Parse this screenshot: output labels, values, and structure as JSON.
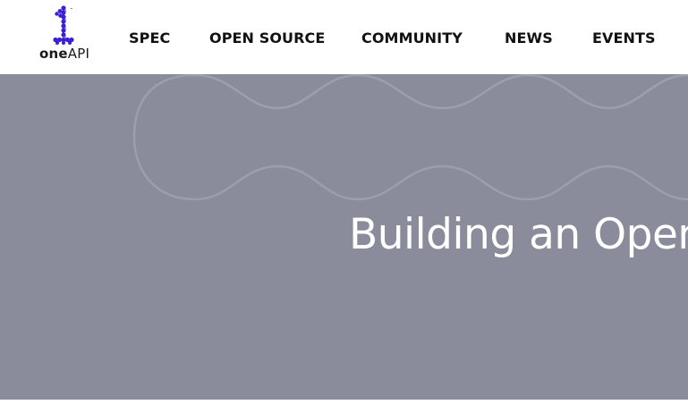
{
  "brand": {
    "logo_icon": "oneapi-logo-icon",
    "logo_text_bold": "one",
    "logo_text_light": "API",
    "trademark": "™",
    "logo_color": "#3b1fd6"
  },
  "nav": {
    "items": [
      {
        "label": "SPEC"
      },
      {
        "label": "OPEN SOURCE"
      },
      {
        "label": "COMMUNITY"
      },
      {
        "label": "NEWS"
      },
      {
        "label": "EVENTS"
      }
    ]
  },
  "hero": {
    "title": "Building an Open",
    "background_color": "#8a8c9b",
    "text_color": "#ffffff"
  }
}
